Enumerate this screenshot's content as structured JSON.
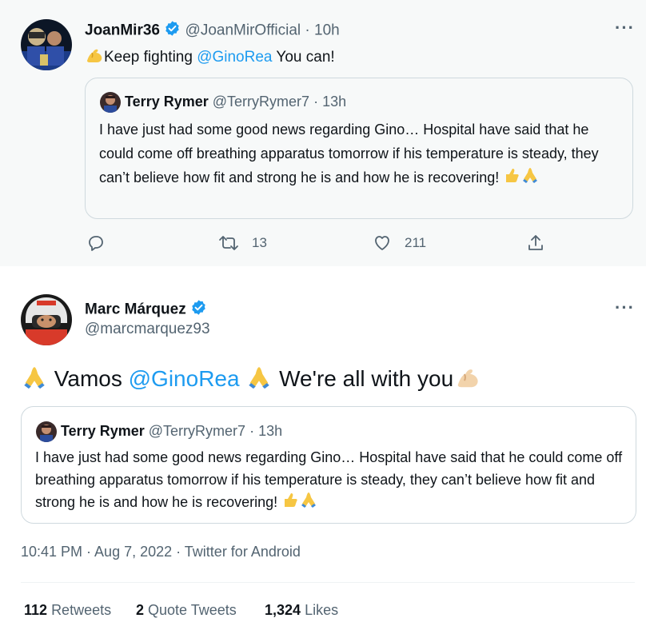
{
  "tweet1": {
    "author_name": "JoanMir36",
    "handle": "@JoanMirOfficial",
    "separator": "·",
    "time": "10h",
    "text_before": "Keep fighting ",
    "mention": "@GinoRea",
    "text_after": " You can!",
    "quote": {
      "author_name": "Terry Rymer",
      "handle": "@TerryRymer7",
      "separator": "·",
      "time": "13h",
      "text": "I have just had some good news regarding Gino… Hospital have said that he could come off breathing apparatus tomorrow if his temperature is steady, they can’t believe how fit and strong he is and how he is recovering!"
    },
    "actions": {
      "reply_icon": "reply-icon",
      "retweet_count": "13",
      "like_count": "211",
      "share_icon": "share-icon"
    }
  },
  "tweet2": {
    "author_name": "Marc Márquez",
    "handle": "@marcmarquez93",
    "text_part1": " Vamos ",
    "mention": "@GinoRea",
    "text_part2": " We're all with you",
    "quote": {
      "author_name": "Terry Rymer",
      "handle": "@TerryRymer7",
      "separator": "·",
      "time": "13h",
      "text": "I have just had some good news regarding Gino… Hospital have said that he could come off breathing apparatus tomorrow if his temperature is steady, they can’t believe how fit and strong he is and how he is recovering!"
    },
    "timestamp": "10:41 PM · Aug 7, 2022 · Twitter for Android",
    "stats": {
      "retweets_count": "112",
      "retweets_label": "Retweets",
      "quote_count": "2",
      "quote_label": "Quote Tweets",
      "likes_count": "1,324",
      "likes_label": "Likes"
    }
  },
  "colors": {
    "link": "#1d9bf0",
    "muted": "#536471",
    "border": "#cfd9de",
    "background_alt": "#f7f9f9"
  }
}
